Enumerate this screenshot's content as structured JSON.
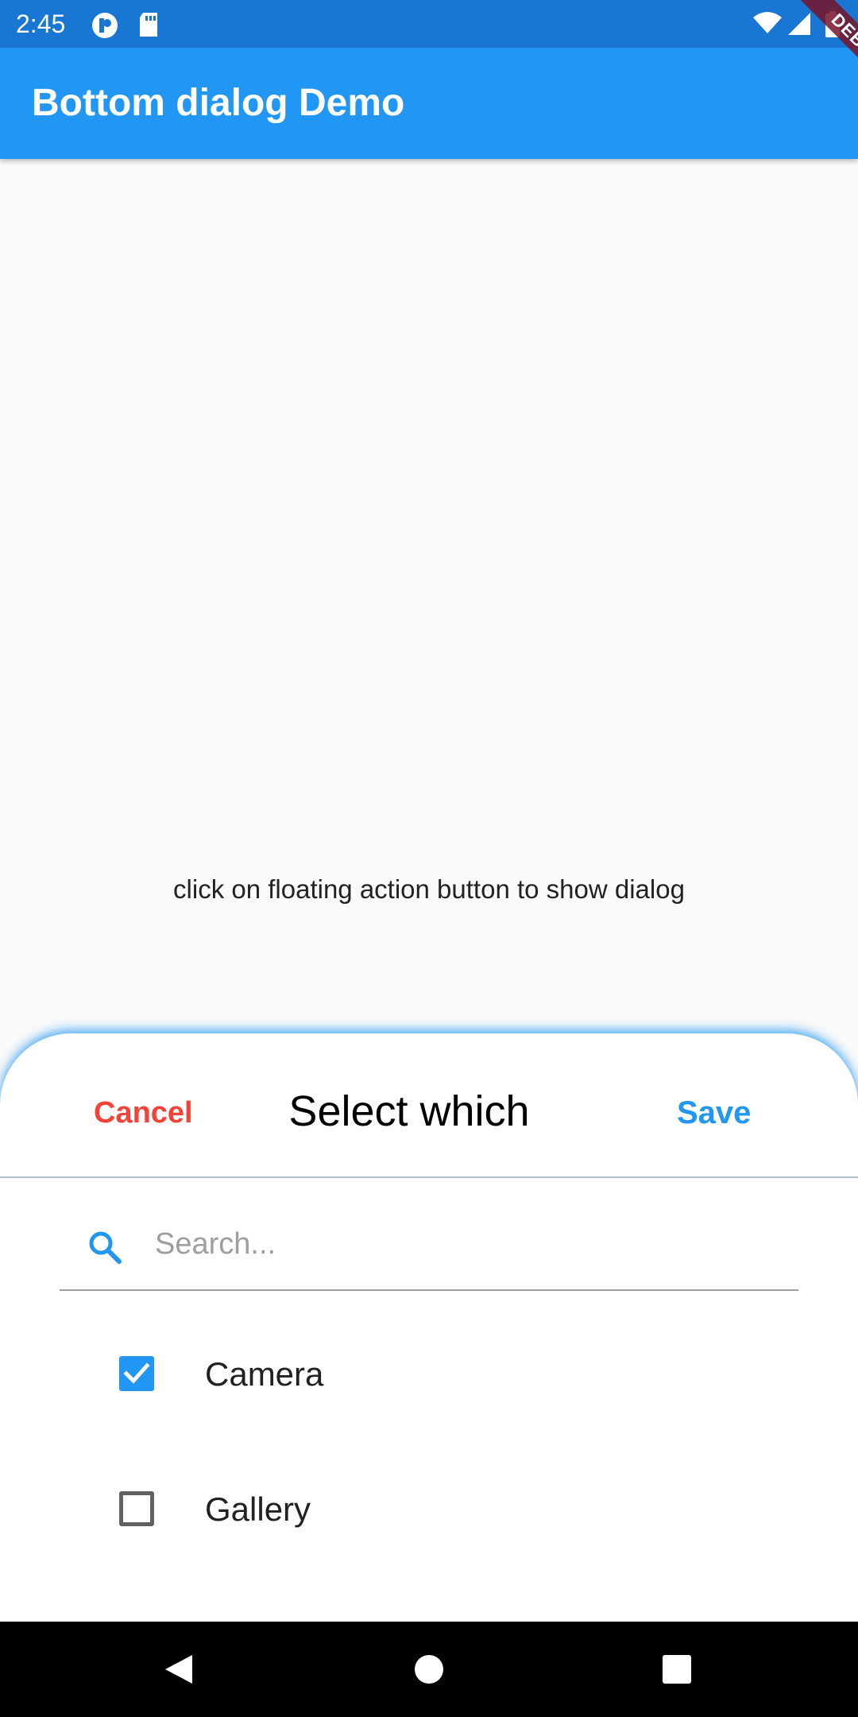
{
  "status_bar": {
    "time": "2:45",
    "icons": [
      "app-notification-icon",
      "sd-card-icon",
      "wifi-icon",
      "signal-icon",
      "battery-icon"
    ]
  },
  "app_bar": {
    "title": "Bottom dialog Demo"
  },
  "debug_banner": {
    "label": "DEBUG"
  },
  "body": {
    "hint": "click on floating action button to show dialog"
  },
  "dialog": {
    "cancel_label": "Cancel",
    "title": "Select which",
    "save_label": "Save",
    "search": {
      "placeholder": "Search...",
      "value": ""
    },
    "options": [
      {
        "label": "Camera",
        "checked": true
      },
      {
        "label": "Gallery",
        "checked": false
      }
    ]
  },
  "nav_bar": {
    "icons": [
      "back-icon",
      "home-icon",
      "recents-icon"
    ]
  },
  "colors": {
    "app_bar": "#2196f3",
    "status_bar": "#1976d2",
    "cancel": "#f44336",
    "save": "#2196f3",
    "checkbox_checked": "#2196f3"
  }
}
